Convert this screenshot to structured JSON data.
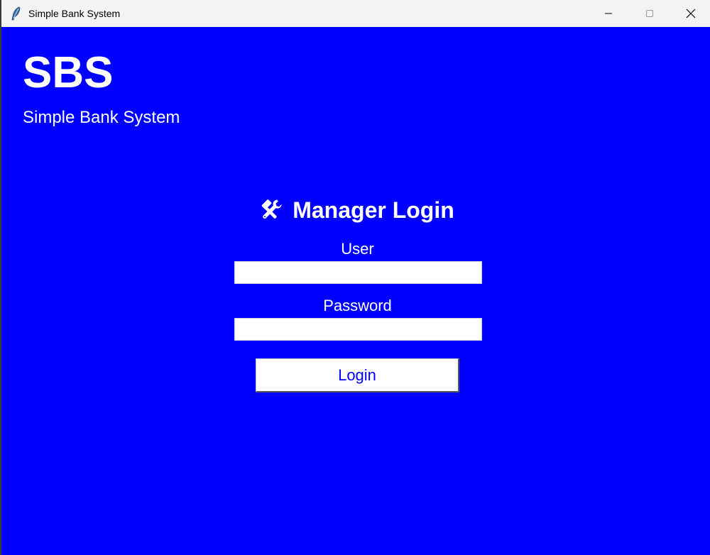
{
  "window": {
    "title": "Simple Bank System"
  },
  "brand": {
    "title": "SBS",
    "subtitle": "Simple Bank System"
  },
  "login": {
    "heading": "Manager Login",
    "heading_icon": "tools-icon",
    "user_label": "User",
    "user_value": "",
    "password_label": "Password",
    "password_value": "",
    "button_label": "Login"
  },
  "colors": {
    "background": "#0000ff",
    "text": "#ffffff",
    "button_text": "#0000ff"
  }
}
